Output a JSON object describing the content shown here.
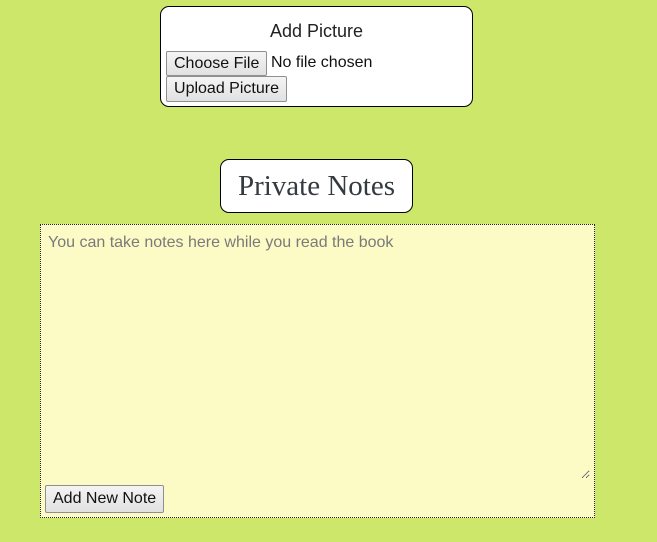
{
  "upload": {
    "title": "Add Picture",
    "choose_label": "Choose File",
    "file_status": "No file chosen",
    "upload_label": "Upload Picture"
  },
  "notes": {
    "heading": "Private Notes",
    "placeholder": "You can take notes here while you read the book",
    "value": "",
    "add_label": "Add New Note"
  },
  "colors": {
    "page_background": "#cde76b",
    "notes_background": "#fcfac5",
    "card_background": "#ffffff"
  }
}
